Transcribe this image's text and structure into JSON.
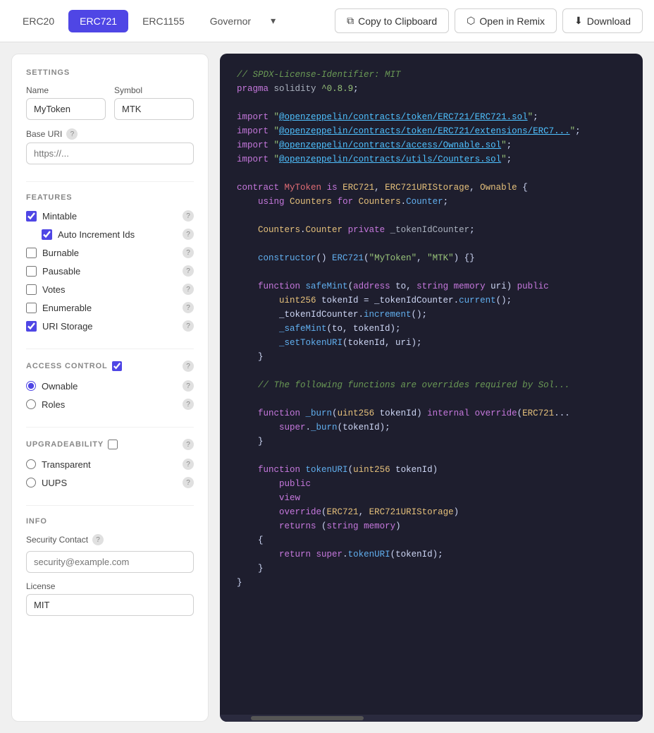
{
  "nav": {
    "tabs": [
      {
        "id": "erc20",
        "label": "ERC20",
        "active": false
      },
      {
        "id": "erc721",
        "label": "ERC721",
        "active": true
      },
      {
        "id": "erc1155",
        "label": "ERC1155",
        "active": false
      },
      {
        "id": "governor",
        "label": "Governor",
        "active": false
      }
    ],
    "more_label": "▾",
    "copy_label": "Copy to Clipboard",
    "remix_label": "Open in Remix",
    "download_label": "Download"
  },
  "settings": {
    "section_label": "SETTINGS",
    "name_label": "Name",
    "name_value": "MyToken",
    "symbol_label": "Symbol",
    "symbol_value": "MTK",
    "base_uri_label": "Base URI",
    "base_uri_placeholder": "https://..."
  },
  "features": {
    "section_label": "FEATURES",
    "items": [
      {
        "id": "mintable",
        "label": "Mintable",
        "checked": true,
        "sub": true
      },
      {
        "id": "auto_increment",
        "label": "Auto Increment Ids",
        "checked": true,
        "indent": true
      },
      {
        "id": "burnable",
        "label": "Burnable",
        "checked": false
      },
      {
        "id": "pausable",
        "label": "Pausable",
        "checked": false
      },
      {
        "id": "votes",
        "label": "Votes",
        "checked": false
      },
      {
        "id": "enumerable",
        "label": "Enumerable",
        "checked": false
      },
      {
        "id": "uri_storage",
        "label": "URI Storage",
        "checked": true
      }
    ]
  },
  "access_control": {
    "section_label": "ACCESS CONTROL",
    "enabled": true,
    "options": [
      {
        "id": "ownable",
        "label": "Ownable",
        "selected": true
      },
      {
        "id": "roles",
        "label": "Roles",
        "selected": false
      }
    ]
  },
  "upgradeability": {
    "section_label": "UPGRADEABILITY",
    "enabled": false,
    "options": [
      {
        "id": "transparent",
        "label": "Transparent",
        "selected": false
      },
      {
        "id": "uups",
        "label": "UUPS",
        "selected": false
      }
    ]
  },
  "info": {
    "section_label": "INFO",
    "security_contact_label": "Security Contact",
    "security_contact_placeholder": "security@example.com",
    "license_label": "License",
    "license_value": "MIT"
  },
  "code": {
    "lines": [
      "// SPDX-License-Identifier: MIT",
      "pragma solidity ^0.8.9;",
      "",
      "import \"@openzeppelin/contracts/token/ERC721/ERC721.sol\";",
      "import \"@openzeppelin/contracts/token/ERC721/extensions/ERC7...\";",
      "import \"@openzeppelin/contracts/access/Ownable.sol\";",
      "import \"@openzeppelin/contracts/utils/Counters.sol\";",
      "",
      "contract MyToken is ERC721, ERC721URIStorage, Ownable {",
      "    using Counters for Counters.Counter;",
      "",
      "    Counters.Counter private _tokenIdCounter;",
      "",
      "    constructor() ERC721(\"MyToken\", \"MTK\") {}",
      "",
      "    function safeMint(address to, string memory uri) public",
      "        uint256 tokenId = _tokenIdCounter.current();",
      "        _tokenIdCounter.increment();",
      "        _safeMint(to, tokenId);",
      "        _setTokenURI(tokenId, uri);",
      "    }",
      "",
      "    // The following functions are overrides required by Sol...",
      "",
      "    function _burn(uint256 tokenId) internal override(ERC721...",
      "        super._burn(tokenId);",
      "    }",
      "",
      "    function tokenURI(uint256 tokenId)",
      "        public",
      "        view",
      "        override(ERC721, ERC721URIStorage)",
      "        returns (string memory)",
      "    {",
      "        return super.tokenURI(tokenId);",
      "    }",
      "}"
    ]
  }
}
